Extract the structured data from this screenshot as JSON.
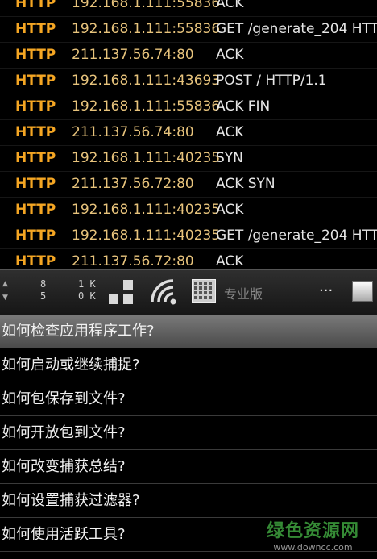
{
  "packets": [
    {
      "proto": "HTTP",
      "addr": "192.168.1.111",
      "port": "55836",
      "info": "ACK"
    },
    {
      "proto": "HTTP",
      "addr": "192.168.1.111",
      "port": "55836",
      "info": "GET /generate_204 HTT..."
    },
    {
      "proto": "HTTP",
      "addr": "211.137.56.74",
      "port": "80",
      "info": "ACK"
    },
    {
      "proto": "HTTP",
      "addr": "192.168.1.111",
      "port": "43693",
      "info": "POST / HTTP/1.1"
    },
    {
      "proto": "HTTP",
      "addr": "192.168.1.111",
      "port": "55836",
      "info": "ACK FIN"
    },
    {
      "proto": "HTTP",
      "addr": "211.137.56.74",
      "port": "80",
      "info": "ACK"
    },
    {
      "proto": "HTTP",
      "addr": "192.168.1.111",
      "port": "40235",
      "info": "SYN"
    },
    {
      "proto": "HTTP",
      "addr": "211.137.56.72",
      "port": "80",
      "info": "ACK SYN"
    },
    {
      "proto": "HTTP",
      "addr": "192.168.1.111",
      "port": "40235",
      "info": "ACK"
    },
    {
      "proto": "HTTP",
      "addr": "192.168.1.111",
      "port": "40235",
      "info": "GET /generate_204 HTT..."
    },
    {
      "proto": "HTTP",
      "addr": "211.137.56.72",
      "port": "80",
      "info": "ACK"
    }
  ],
  "toolbar": {
    "arrow_up": "▲",
    "arrow_down": "▼",
    "count_top": "8",
    "count_bottom": "5",
    "kb_top": "1 K",
    "kb_bottom": "0 K",
    "pro_label": "专业版",
    "more_label": "...",
    "icons": [
      "layout-boxes-icon",
      "wifi-signal-icon",
      "grid-icon",
      "square-icon"
    ]
  },
  "menu": [
    {
      "label": "如何检查应用程序工作?",
      "selected": true
    },
    {
      "label": "如何启动或继续捕捉?"
    },
    {
      "label": "如何包保存到文件?"
    },
    {
      "label": "如何开放包到文件?"
    },
    {
      "label": "如何改变捕获总结?"
    },
    {
      "label": "如何设置捕获过滤器?"
    },
    {
      "label": "如何使用活跃工具?"
    }
  ],
  "watermark": {
    "main": "绿色资源网",
    "sub": "www.downcc.com"
  },
  "colors": {
    "proto": "#f5a623",
    "addr": "#e7c37c",
    "info": "#e6e6e6",
    "watermark": "#3fa33f"
  }
}
